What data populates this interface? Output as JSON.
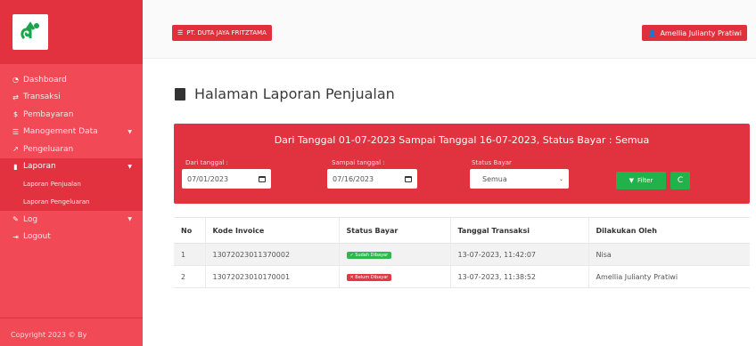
{
  "sidebar": {
    "items": [
      {
        "icon": "dashboard-icon",
        "label": "Dashboard"
      },
      {
        "icon": "exchange-icon",
        "label": "Transaksi"
      },
      {
        "icon": "dollar-icon",
        "label": "Pembayaran"
      },
      {
        "icon": "list-icon",
        "label": "Manogement Data"
      },
      {
        "icon": "external-link-icon",
        "label": "Pengeluaran"
      },
      {
        "icon": "file-icon",
        "label": "Laporan"
      }
    ],
    "submenu": [
      "Laporan Penjualan",
      "Laporan Pengeluaran"
    ],
    "items_after": [
      {
        "icon": "pen-icon",
        "label": "Log"
      },
      {
        "icon": "logout-icon",
        "label": "Logout"
      }
    ],
    "copyright": "Copyright 2023 © By"
  },
  "header": {
    "company": "PT. DUTA JAYA FRITZTAMA",
    "user": "Amellia Julianty Pratiwi"
  },
  "page": {
    "title": "Halaman Laporan Penjualan"
  },
  "filter": {
    "heading": "Dari Tanggal 01-07-2023 Sampai Tanggal 16-07-2023, Status Bayar : Semua",
    "from_label": "Dari tanggal :",
    "from_value": "07/01/2023",
    "to_label": "Sampai tanggal :",
    "to_value": "07/16/2023",
    "status_label": "Status Bayar",
    "status_value": "Semua",
    "filter_button": "Filter",
    "reset_button": "C"
  },
  "table": {
    "headers": [
      "No",
      "Kode Invoice",
      "Status Bayar",
      "Tanggal Transaksi",
      "Dilakukan Oleh"
    ],
    "rows": [
      {
        "no": "1",
        "invoice": "13072023011370002",
        "status": "✓ Sudah Dibayar",
        "date": "13-07-2023, 11:42:07",
        "by": "Nisa"
      },
      {
        "no": "2",
        "invoice": "13072023010170001",
        "status": "✕ Belum Dibayar",
        "date": "13-07-2023, 11:38:52",
        "by": "Amellia Julianty Pratiwi"
      }
    ]
  },
  "colors": {
    "sidebar": "#f14a56",
    "accent": "#e0323f",
    "success": "#22b24c",
    "paid": "#2bb84f",
    "unpaid": "#e53645"
  }
}
